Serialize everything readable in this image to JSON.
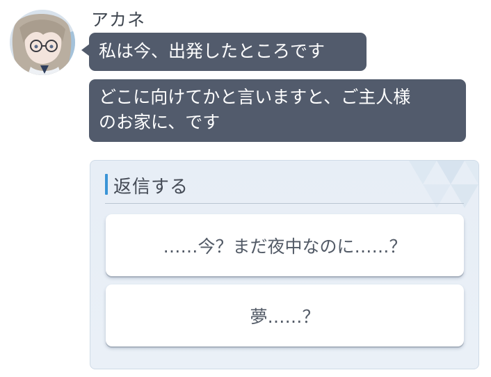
{
  "chat": {
    "sender": "アカネ",
    "messages": [
      {
        "text": "私は今、出発したところです"
      },
      {
        "line1": "どこに向けてかと言いますと、ご主人様",
        "line2": "のお家に、です"
      }
    ]
  },
  "reply": {
    "title": "返信する",
    "options": [
      {
        "label": "……今？まだ夜中なのに……？"
      },
      {
        "label": "夢……？"
      }
    ]
  },
  "colors": {
    "bubble": "#525b6c",
    "accent": "#3a94d6",
    "panel": "#e7eef6"
  }
}
